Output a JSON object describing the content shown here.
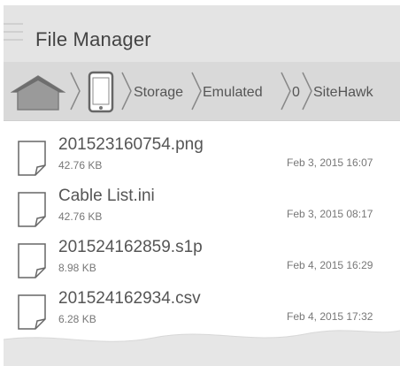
{
  "app": {
    "title": "File Manager"
  },
  "breadcrumb": {
    "icons": [
      "home-icon",
      "phone-icon"
    ],
    "items": [
      "Storage",
      "Emulated",
      "0",
      "SiteHawk"
    ]
  },
  "files": [
    {
      "name": "201523160754.png",
      "size": "42.76 KB",
      "date": "Feb 3, 2015 16:07",
      "icon": "file-icon"
    },
    {
      "name": "Cable List.ini",
      "size": "42.76 KB",
      "date": "Feb 3, 2015 08:17",
      "icon": "file-icon"
    },
    {
      "name": "201524162859.s1p",
      "size": "8.98 KB",
      "date": "Feb 4, 2015 16:29",
      "icon": "file-icon"
    },
    {
      "name": "201524162934.csv",
      "size": "6.28 KB",
      "date": "Feb 4, 2015 17:32",
      "icon": "file-icon"
    }
  ],
  "colors": {
    "title_bar": "#e4e4e4",
    "breadcrumb_bar": "#d9d9d9",
    "text": "#555555"
  }
}
